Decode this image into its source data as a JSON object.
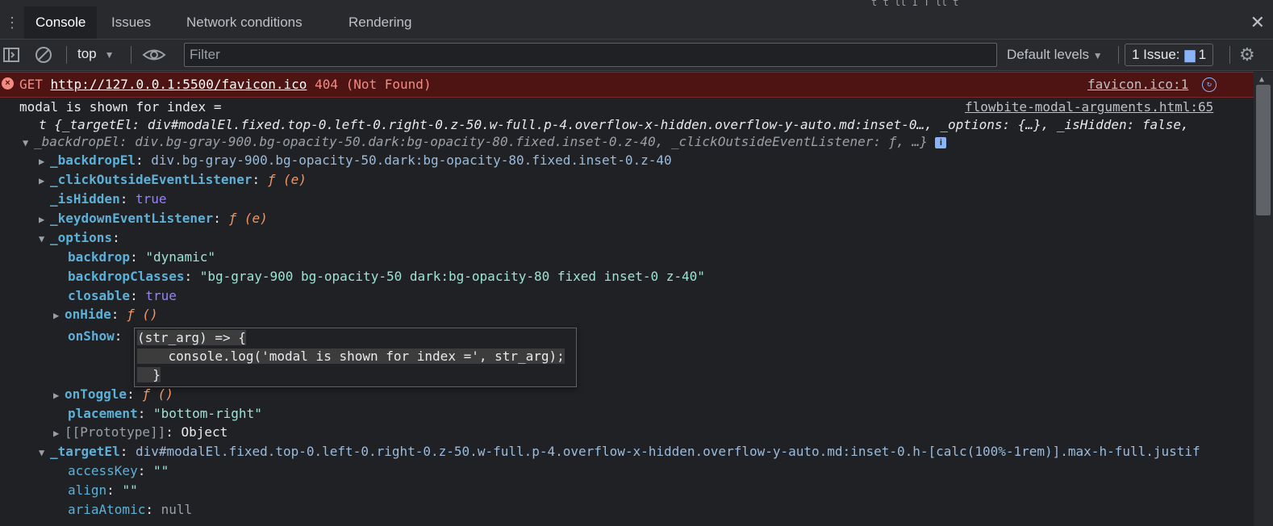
{
  "topstrip": {
    "fragment": "t    t          ll I T         ll    t"
  },
  "tabs": [
    {
      "label": "Console",
      "active": true
    },
    {
      "label": "Issues",
      "active": false
    },
    {
      "label": "Network conditions",
      "active": false
    },
    {
      "label": "Rendering",
      "active": false
    }
  ],
  "toolbar": {
    "context": "top",
    "filter_placeholder": "Filter",
    "levels": "Default levels",
    "issues_label": "1 Issue:",
    "issues_count": "1"
  },
  "error": {
    "method": "GET",
    "url": "http://127.0.0.1:5500/favicon.ico",
    "status": "404 (Not Found)",
    "source": "favicon.ico:1"
  },
  "log": {
    "message": "modal is shown for index =",
    "source": "flowbite-modal-arguments.html:65",
    "summary1": "t {_targetEl: div#modalEl.fixed.top-0.left-0.right-0.z-50.w-full.p-4.overflow-x-hidden.overflow-y-auto.md:inset-0…, _options: {…}, _isHidden: false,",
    "summary2": "_backdropEl: div.bg-gray-900.bg-opacity-50.dark:bg-opacity-80.fixed.inset-0.z-40, _clickOutsideEventListener: ƒ, …}"
  },
  "props": {
    "backdropEl_key": "_backdropEl",
    "backdropEl_val": "div.bg-gray-900.bg-opacity-50.dark:bg-opacity-80.fixed.inset-0.z-40",
    "clickOutside_key": "_clickOutsideEventListener",
    "clickOutside_val": "ƒ (e)",
    "isHidden_key": "_isHidden",
    "isHidden_val": "true",
    "keydown_key": "_keydownEventListener",
    "keydown_val": "ƒ (e)",
    "options_key": "_options",
    "backdrop_key": "backdrop",
    "backdrop_val": "\"dynamic\"",
    "backdropClasses_key": "backdropClasses",
    "backdropClasses_val": "\"bg-gray-900 bg-opacity-50 dark:bg-opacity-80 fixed inset-0 z-40\"",
    "closable_key": "closable",
    "closable_val": "true",
    "onHide_key": "onHide",
    "onHide_val": "ƒ ()",
    "onShow_key": "onShow",
    "onToggle_key": "onToggle",
    "onToggle_val": "ƒ ()",
    "placement_key": "placement",
    "placement_val": "\"bottom-right\"",
    "prototype_key": "[[Prototype]]",
    "prototype_val": "Object",
    "targetEl_key": "_targetEl",
    "targetEl_val": "div#modalEl.fixed.top-0.left-0.right-0.z-50.w-full.p-4.overflow-x-hidden.overflow-y-auto.md:inset-0.h-[calc(100%-1rem)].max-h-full.justif",
    "accessKey_key": "accessKey",
    "accessKey_val": "\"\"",
    "align_key": "align",
    "align_val": "\"\"",
    "ariaAtomic_key": "ariaAtomic",
    "ariaAtomic_val": "null"
  },
  "popup": {
    "line1": "(str_arg) => {",
    "line2": "    console.log('modal is shown for index =', str_arg);",
    "line3": "  }"
  },
  "colors": {
    "accent": "#8ab4f8",
    "error_bg": "#4e1313",
    "background": "#202124"
  }
}
